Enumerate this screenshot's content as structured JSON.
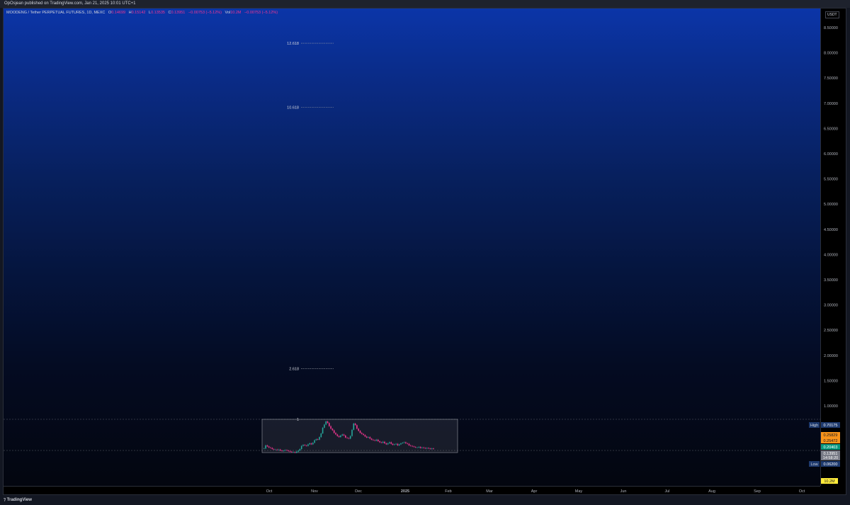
{
  "header": {
    "publish_text": "OpOsjean published on TradingView.com, Jan 21, 2025 10:01 UTC+1"
  },
  "legend": {
    "symbol": "MOODENG / Tether PERPETUAL FUTURES, 1D, MEXC",
    "o_label": "O",
    "o_value": "0.14699",
    "h_label": "H",
    "h_value": "0.15142",
    "l_label": "L",
    "l_value": "0.13535",
    "c_label": "C",
    "c_value": "0.13951",
    "change": "−0.00753 (−5.12%)",
    "vol_label": "Vol",
    "vol_value": "10.2M",
    "vol_change": "−0.00753 (−5.12%)"
  },
  "axis": {
    "currency": "USDT"
  },
  "footer": {
    "brand": "TradingView"
  },
  "colors": {
    "bull": "#26a69a",
    "bear": "#f23690",
    "high_tag": "#1e3a6e",
    "tag_orange": "#f7931a",
    "tag_teal": "#089981",
    "tag_gray": "#787b86",
    "tag_yellow": "#ffeb3b"
  },
  "chart_data": {
    "type": "candlestick",
    "title": "MOODENG / Tether PERPETUAL FUTURES, 1D, MEXC",
    "y_ticks": [
      "8.50000",
      "8.00000",
      "7.50000",
      "7.00000",
      "6.50000",
      "6.00000",
      "5.50000",
      "5.00000",
      "4.50000",
      "4.00000",
      "3.50000",
      "3.00000",
      "2.50000",
      "2.00000",
      "1.50000",
      "1.00000"
    ],
    "ylim": [
      0,
      8.7
    ],
    "x_ticks": [
      "Oct",
      "Nov",
      "Dec",
      "2025",
      "Feb",
      "Mar",
      "Apr",
      "May",
      "Jun",
      "Jul",
      "Aug",
      "Sep",
      "Oct"
    ],
    "fib_levels": [
      {
        "label": "12.618",
        "value": 8.19
      },
      {
        "label": "10.618",
        "value": 6.92
      },
      {
        "label": "2.618",
        "value": 1.74
      },
      {
        "label": "1",
        "value": 0.70175
      }
    ],
    "price_tags": [
      {
        "prefix": "High",
        "value": "0.70175",
        "price": 0.70175,
        "color": "high_tag"
      },
      {
        "prefix": "",
        "value": "0.25829",
        "price": 0.25829,
        "color": "tag_orange"
      },
      {
        "prefix": "",
        "value": "0.25472",
        "price": 0.25472,
        "color": "tag_orange"
      },
      {
        "prefix": "",
        "value": "0.20403",
        "price": 0.20403,
        "color": "tag_teal"
      },
      {
        "prefix": "",
        "value": "0.13951",
        "price": 0.13951,
        "color": "tag_gray"
      },
      {
        "prefix": "",
        "value": "14:58:20",
        "price": 0.09,
        "color": "tag_gray"
      },
      {
        "prefix": "Low",
        "value": "0.06200",
        "price": 0.062,
        "color": "high_tag"
      }
    ],
    "volume_tag": "10.2M",
    "candle_closes": [
      0.14,
      0.2,
      0.18,
      0.16,
      0.15,
      0.13,
      0.12,
      0.12,
      0.11,
      0.12,
      0.1,
      0.09,
      0.1,
      0.11,
      0.1,
      0.09,
      0.08,
      0.07,
      0.07,
      0.06,
      0.08,
      0.1,
      0.13,
      0.19,
      0.21,
      0.2,
      0.19,
      0.22,
      0.24,
      0.22,
      0.25,
      0.3,
      0.32,
      0.31,
      0.36,
      0.43,
      0.54,
      0.6,
      0.66,
      0.63,
      0.57,
      0.52,
      0.49,
      0.44,
      0.41,
      0.38,
      0.36,
      0.39,
      0.41,
      0.39,
      0.35,
      0.34,
      0.33,
      0.38,
      0.5,
      0.62,
      0.59,
      0.52,
      0.48,
      0.44,
      0.42,
      0.4,
      0.37,
      0.35,
      0.36,
      0.33,
      0.31,
      0.3,
      0.29,
      0.31,
      0.28,
      0.26,
      0.25,
      0.27,
      0.24,
      0.22,
      0.24,
      0.26,
      0.23,
      0.21,
      0.22,
      0.23,
      0.2,
      0.22,
      0.24,
      0.25,
      0.26,
      0.24,
      0.23,
      0.2,
      0.19,
      0.18,
      0.17,
      0.16,
      0.16,
      0.17,
      0.15,
      0.16,
      0.15,
      0.14,
      0.15,
      0.14,
      0.13,
      0.14,
      0.13
    ]
  }
}
